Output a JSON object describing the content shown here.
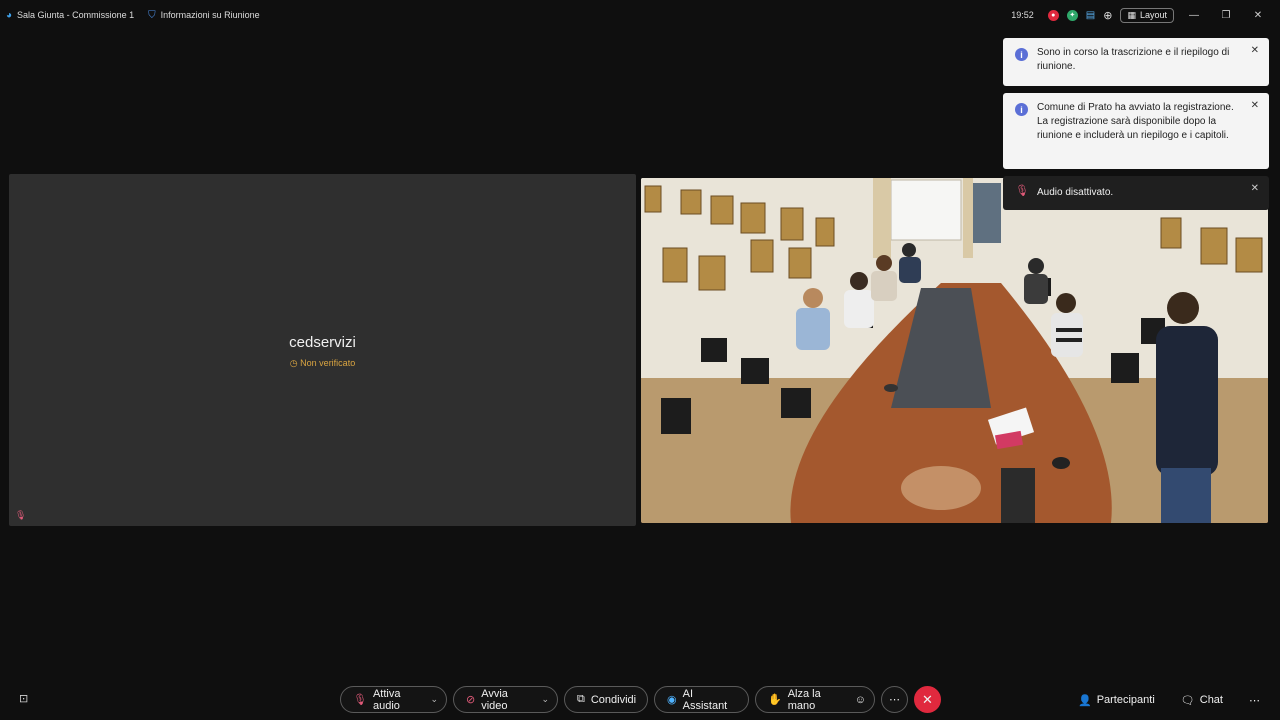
{
  "titlebar": {
    "app_title": "Sala Giunta - Commissione 1",
    "meeting_info": "Informazioni su Riunione",
    "time": "19:52",
    "layout_label": "Layout"
  },
  "left_tile": {
    "name": "cedservizi",
    "status": "Non verificato"
  },
  "notifications": [
    {
      "text": "Sono in corso la trascrizione e il riepilogo di riunione."
    },
    {
      "text": "Comune di Prato ha avviato la registrazione. La registrazione sarà disponibile dopo la riunione e includerà un riepilogo e i capitoli."
    },
    {
      "text": "Audio disattivato."
    }
  ],
  "controls": {
    "audio": "Attiva audio",
    "video": "Avvia video",
    "share": "Condividi",
    "ai": "AI Assistant",
    "raise_hand": "Alza la mano",
    "participants": "Partecipanti",
    "chat": "Chat"
  },
  "colors": {
    "end_call": "#e0293e",
    "muted": "#e35b7a",
    "unverified": "#d9a441",
    "info": "#5b6fd6"
  }
}
